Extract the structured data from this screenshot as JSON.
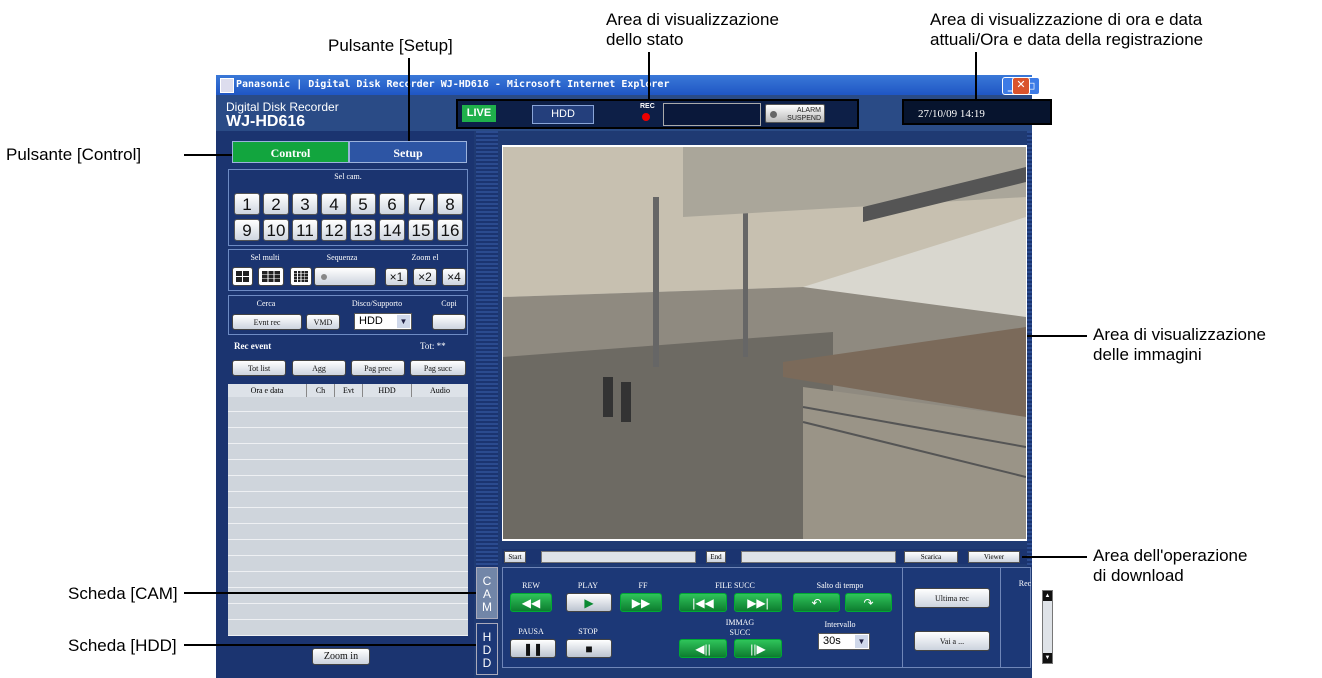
{
  "window": {
    "title": "Panasonic | Digital Disk Recorder WJ-HD616 - Microsoft Internet Explorer",
    "min_glyph": "_",
    "max_glyph": "□",
    "close_glyph": "✕"
  },
  "header": {
    "product_line": "Digital Disk Recorder",
    "model": "WJ-HD616"
  },
  "status": {
    "live": "LIVE",
    "hdd": "HDD",
    "rec": "REC",
    "alarm_line1": "ALARM",
    "alarm_line2": "SUSPEND",
    "datetime": "27/10/09  14:19"
  },
  "tabs": {
    "control": "Control",
    "setup": "Setup"
  },
  "camera_select": {
    "label": "Sel cam.",
    "buttons": [
      "1",
      "2",
      "3",
      "4",
      "5",
      "6",
      "7",
      "8",
      "9",
      "10",
      "11",
      "12",
      "13",
      "14",
      "15",
      "16"
    ]
  },
  "multi": {
    "sel_multi": "Sel multi",
    "sequenza": "Sequenza",
    "zoom_el": "Zoom el",
    "zoom_buttons": [
      "×1",
      "×2",
      "×4"
    ]
  },
  "search": {
    "cerca": "Cerca",
    "disco": "Disco/Supporto",
    "copi": "Copi",
    "evnt_rec": "Evnt rec",
    "vmd": "VMD",
    "hdd_option": "HDD"
  },
  "rec_event": {
    "title": "Rec event",
    "total": "Tot: **",
    "tot_list": "Tot list",
    "agg": "Agg",
    "pag_prec": "Pag prec",
    "pag_succ": "Pag succ",
    "columns": [
      "Ora e data",
      "Ch",
      "Evt",
      "HDD",
      "Audio"
    ]
  },
  "zoom_in": "Zoom in",
  "side_tabs": {
    "cam": [
      "C",
      "A",
      "M"
    ],
    "hdd": [
      "H",
      "D",
      "D"
    ]
  },
  "download": {
    "start": "Start",
    "end": "End",
    "scarica": "Scarica",
    "viewer": "Viewer"
  },
  "playback": {
    "rew": "REW",
    "play": "PLAY",
    "ff": "FF",
    "file_succ": "FILE SUCC",
    "salto": "Salto di tempo",
    "pausa": "PAUSA",
    "stop": "STOP",
    "immag": "IMMAG",
    "succ": "SUCC",
    "intervallo": "Intervallo",
    "interval_value": "30s",
    "ultima_rec": "Ultima rec",
    "vai_a": "Vai a ...",
    "rec": "Rec"
  },
  "callouts": {
    "setup": "Pulsante [Setup]",
    "status_1": "Area di visualizzazione",
    "status_2": "dello stato",
    "datetime_1": "Area di visualizzazione di ora e data",
    "datetime_2": "attuali/Ora e data della registrazione",
    "control": "Pulsante [Control]",
    "image_1": "Area di visualizzazione",
    "image_2": "delle immagini",
    "download_1": "Area dell'operazione",
    "download_2": "di download",
    "cam_tab": "Scheda [CAM]",
    "hdd_tab": "Scheda [HDD]"
  },
  "colors": {
    "live_green": "#1fb04b",
    "control_green": "#12a53e",
    "panel_navy": "#1b3470",
    "title_blue": "#1f56c4",
    "rec_red": "#e00000"
  }
}
